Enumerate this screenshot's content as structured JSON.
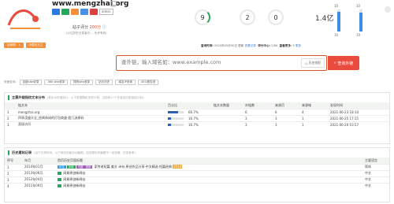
{
  "header": {
    "domain": "www.mengzhai.org",
    "mini_badge": "aliexs",
    "score_label": "站子评分",
    "score_value": "200",
    "score_suffix": "分",
    "score_sub": "(以往历史记录者可..., 也许有效)"
  },
  "stats": [
    {
      "value": "9",
      "label": ""
    },
    {
      "value": "2",
      "label": ""
    },
    {
      "value": "0",
      "label": ""
    },
    {
      "value": "1.4亿",
      "label": ""
    }
  ],
  "vbars": [
    {
      "top": "10",
      "bottom": "10",
      "fill": 0.9
    },
    {
      "top": "10",
      "bottom": "10",
      "fill": 0.85
    }
  ],
  "tags": [
    {
      "label": "站龄期 · 1",
      "color": "#f2913b"
    },
    {
      "label": "中国天天之",
      "color": "#f2913b"
    }
  ],
  "meta": {
    "label": "查询时间:",
    "update_time": "2024年05月30日 更新",
    "link": "查看记录",
    "text2": "评分中心:",
    "text2_value": "2/84",
    "text3": "查看更多:",
    "text3_value": "5",
    "lnk2": "更多"
  },
  "search": {
    "placeholder": "查外链，输入域名如：www.example.com",
    "history_label": "历史快照",
    "button_label": "查询外链"
  },
  "chips_lead": "快速查询:",
  "chips": [
    "百度site收录",
    "360 site收录",
    "搜狗site收录",
    "站长历史",
    "域名IP查询",
    "SEO报告查"
  ],
  "panel1": {
    "title": "主要外链指纹文本分布",
    "subtitle": "(表示为外链统计，以下数据随机采样计算，当前有17个外链站可用链接分析)",
    "columns": [
      "",
      "链文本",
      "百分比",
      "",
      "链文本数量",
      "外链数",
      "来源页",
      "来源域",
      "发现时间"
    ],
    "rows": [
      {
        "n": "1",
        "text": "mengzhai.org",
        "pct": "66.7%",
        "fill": 0.667,
        "count": "",
        "links": "6",
        "src": "6",
        "dom": "4",
        "date": "2021-06-23 18:10"
      },
      {
        "n": "2",
        "text": "四季茂盛大全_经典休闲的打包商盛-超几流原码",
        "pct": "16.7%",
        "fill": 0.167,
        "count": "",
        "links": "3",
        "src": "3",
        "dom": "1",
        "date": "2021-06-25 17:15"
      },
      {
        "n": "3",
        "text": "直接访问",
        "pct": "16.7%",
        "fill": 0.167,
        "count": "",
        "links": "3",
        "src": "3",
        "dom": "1",
        "date": "2021-06-20 03:57"
      }
    ]
  },
  "panel2": {
    "title": "历史建站记录",
    "subtitle": "(由于记录时间，以下网页页面自动截图，如查看历史截图不一定准确，仅供参考)",
    "columns": [
      "序号",
      "年月",
      "首页历史页面标题",
      "主要语言"
    ],
    "rows": [
      {
        "n": "1",
        "date": "2014年01月",
        "tags": [
          {
            "t": "中文",
            "c": "#2f9ef0"
          },
          {
            "t": "页面",
            "c": "#2aa65c"
          },
          {
            "t": "内嵌 · 视频",
            "c": "#9b59b6"
          }
        ],
        "title": "家传老短篇 美文 诗句·原创作品分享·中文精选·短篇经典",
        "hl": "2014",
        "lang": "简体"
      },
      {
        "n": "2",
        "date": "2013年06月",
        "tags": [
          {
            "t": "",
            "c": "#2aa65c"
          }
        ],
        "title": "网易原创新闻站",
        "hl": "",
        "lang": "中文"
      },
      {
        "n": "3",
        "date": "2012年04月",
        "tags": [
          {
            "t": "",
            "c": "#2aa65c"
          }
        ],
        "title": "网易原创新闻站",
        "hl": "",
        "lang": "中文"
      },
      {
        "n": "4",
        "date": "2011年09月",
        "tags": [
          {
            "t": "",
            "c": "#2aa65c"
          }
        ],
        "title": "网易原创新闻站",
        "hl": "",
        "lang": "中文"
      }
    ]
  }
}
